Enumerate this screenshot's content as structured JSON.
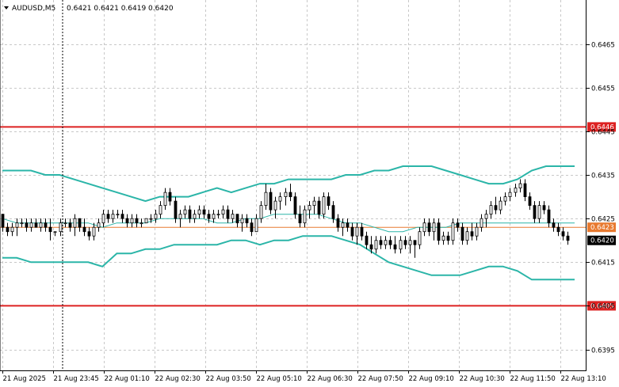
{
  "header": {
    "symbol": "AUDUSD,M5",
    "quote": "0.6421 0.6421 0.6419 0.6420",
    "menu_icon": "triangle-down-icon"
  },
  "chart_data": {
    "type": "candlestick",
    "symbol": "AUDUSD",
    "timeframe": "M5",
    "ylim": [
      0.63902,
      0.64751
    ],
    "y_ticks": [
      "0.6465",
      "0.6455",
      "0.6445",
      "0.6435",
      "0.6425",
      "0.6415",
      "0.6405",
      "0.6395"
    ],
    "y_tick_values": [
      0.6465,
      0.6455,
      0.6445,
      0.6435,
      0.6425,
      0.6415,
      0.6405,
      0.6395
    ],
    "x_ticks": [
      "21 Aug 2025",
      "21 Aug 23:45",
      "22 Aug 01:10",
      "22 Aug 02:30",
      "22 Aug 03:50",
      "22 Aug 05:10",
      "22 Aug 06:30",
      "22 Aug 07:50",
      "22 Aug 09:10",
      "22 Aug 10:30",
      "22 Aug 11:50",
      "22 Aug 13:10"
    ],
    "grid": true,
    "levels": [
      {
        "label": "0.6446",
        "value": 0.6446,
        "color": "#dd2222"
      },
      {
        "label": "0.6405",
        "value": 0.6405,
        "color": "#dd2222"
      }
    ],
    "ref_line": {
      "label": "0.6423",
      "value": 0.6423,
      "color": "#e87a30"
    },
    "bid": {
      "label": "0.6420",
      "value": 0.642,
      "color": "#000000"
    },
    "bands_color": "#2bb5a8",
    "candle_color": "#000000",
    "bollinger": {
      "upper": [
        0.6436,
        0.6436,
        0.6436,
        0.6435,
        0.6435,
        0.6434,
        0.6433,
        0.6432,
        0.6431,
        0.643,
        0.6429,
        0.643,
        0.643,
        0.643,
        0.6431,
        0.6432,
        0.6431,
        0.6432,
        0.6433,
        0.6433,
        0.6434,
        0.6434,
        0.6434,
        0.6434,
        0.6435,
        0.6435,
        0.6436,
        0.6436,
        0.6437,
        0.6437,
        0.6437,
        0.6436,
        0.6435,
        0.6434,
        0.6433,
        0.6433,
        0.6434,
        0.6436,
        0.6437,
        0.6437,
        0.6437
      ],
      "middle": [
        0.6425,
        0.6424,
        0.6424,
        0.6424,
        0.6424,
        0.6424,
        0.6424,
        0.6423,
        0.6424,
        0.6424,
        0.6424,
        0.6425,
        0.6425,
        0.6425,
        0.6425,
        0.6424,
        0.6424,
        0.6425,
        0.6425,
        0.6426,
        0.6426,
        0.6426,
        0.6426,
        0.6425,
        0.6424,
        0.6424,
        0.6423,
        0.6422,
        0.6422,
        0.6423,
        0.6423,
        0.6423,
        0.6424,
        0.6424,
        0.6424,
        0.6424,
        0.6424,
        0.6424,
        0.6424,
        0.6424,
        0.6424
      ],
      "lower": [
        0.6416,
        0.6416,
        0.6415,
        0.6415,
        0.6415,
        0.6415,
        0.6415,
        0.6414,
        0.6417,
        0.6417,
        0.6418,
        0.6418,
        0.6419,
        0.6419,
        0.6419,
        0.6419,
        0.642,
        0.642,
        0.6419,
        0.642,
        0.642,
        0.6421,
        0.6421,
        0.6421,
        0.642,
        0.6419,
        0.6417,
        0.6415,
        0.6414,
        0.6413,
        0.6412,
        0.6412,
        0.6412,
        0.6413,
        0.6414,
        0.6414,
        0.6413,
        0.6411,
        0.6411,
        0.6411,
        0.6411
      ]
    },
    "candles": [
      [
        0.6426,
        0.6425,
        0.6422,
        0.6423
      ],
      [
        0.6423,
        0.6424,
        0.6421,
        0.6422
      ],
      [
        0.6422,
        0.6424,
        0.6421,
        0.6423
      ],
      [
        0.6423,
        0.6425,
        0.6421,
        0.6424
      ],
      [
        0.6424,
        0.6425,
        0.6423,
        0.6424
      ],
      [
        0.6424,
        0.6425,
        0.6422,
        0.6423
      ],
      [
        0.6423,
        0.6425,
        0.6422,
        0.6424
      ],
      [
        0.6424,
        0.6425,
        0.6423,
        0.6423
      ],
      [
        0.6423,
        0.6425,
        0.6422,
        0.6424
      ],
      [
        0.6424,
        0.6425,
        0.6422,
        0.6423
      ],
      [
        0.6423,
        0.6425,
        0.642,
        0.6422
      ],
      [
        0.6422,
        0.6422,
        0.6421,
        0.6422
      ],
      [
        0.6422,
        0.6425,
        0.6421,
        0.6424
      ],
      [
        0.6424,
        0.6425,
        0.6423,
        0.6424
      ],
      [
        0.6424,
        0.6425,
        0.6422,
        0.6423
      ],
      [
        0.6423,
        0.6426,
        0.6421,
        0.6425
      ],
      [
        0.6425,
        0.6425,
        0.6422,
        0.6423
      ],
      [
        0.6423,
        0.6425,
        0.6421,
        0.6422
      ],
      [
        0.6422,
        0.6423,
        0.642,
        0.6421
      ],
      [
        0.6421,
        0.6424,
        0.642,
        0.6423
      ],
      [
        0.6423,
        0.6425,
        0.6422,
        0.6424
      ],
      [
        0.6424,
        0.6427,
        0.6423,
        0.6426
      ],
      [
        0.6426,
        0.6427,
        0.6424,
        0.6425
      ],
      [
        0.6425,
        0.6427,
        0.6424,
        0.6426
      ],
      [
        0.6426,
        0.6427,
        0.6425,
        0.6426
      ],
      [
        0.6426,
        0.6427,
        0.6424,
        0.6425
      ],
      [
        0.6425,
        0.6426,
        0.6423,
        0.6424
      ],
      [
        0.6424,
        0.6426,
        0.6423,
        0.6425
      ],
      [
        0.6425,
        0.6426,
        0.6423,
        0.6424
      ],
      [
        0.6424,
        0.6425,
        0.6423,
        0.6424
      ],
      [
        0.6424,
        0.6425,
        0.6424,
        0.6425
      ],
      [
        0.6425,
        0.6426,
        0.6424,
        0.6425
      ],
      [
        0.6425,
        0.6427,
        0.6424,
        0.6426
      ],
      [
        0.6426,
        0.6429,
        0.6425,
        0.6428
      ],
      [
        0.6428,
        0.6432,
        0.6427,
        0.6431
      ],
      [
        0.6431,
        0.6432,
        0.6428,
        0.6429
      ],
      [
        0.6429,
        0.643,
        0.6424,
        0.6425
      ],
      [
        0.6425,
        0.6427,
        0.6423,
        0.6426
      ],
      [
        0.6426,
        0.6428,
        0.6425,
        0.6427
      ],
      [
        0.6427,
        0.6428,
        0.6424,
        0.6425
      ],
      [
        0.6425,
        0.6427,
        0.6424,
        0.6426
      ],
      [
        0.6426,
        0.6428,
        0.6425,
        0.6427
      ],
      [
        0.6427,
        0.6428,
        0.6425,
        0.6426
      ],
      [
        0.6426,
        0.6427,
        0.6424,
        0.6425
      ],
      [
        0.6425,
        0.6427,
        0.6424,
        0.6426
      ],
      [
        0.6426,
        0.6427,
        0.6425,
        0.6426
      ],
      [
        0.6426,
        0.6428,
        0.6425,
        0.6427
      ],
      [
        0.6427,
        0.6428,
        0.6424,
        0.6425
      ],
      [
        0.6425,
        0.6427,
        0.6424,
        0.6426
      ],
      [
        0.6426,
        0.6426,
        0.6423,
        0.6424
      ],
      [
        0.6424,
        0.6426,
        0.6422,
        0.6425
      ],
      [
        0.6425,
        0.6426,
        0.6423,
        0.6424
      ],
      [
        0.6424,
        0.6425,
        0.6421,
        0.6422
      ],
      [
        0.6422,
        0.6426,
        0.6422,
        0.6425
      ],
      [
        0.6425,
        0.6429,
        0.6424,
        0.6428
      ],
      [
        0.6428,
        0.6433,
        0.6427,
        0.6431
      ],
      [
        0.6431,
        0.6432,
        0.6426,
        0.6427
      ],
      [
        0.6427,
        0.643,
        0.6425,
        0.6429
      ],
      [
        0.6429,
        0.6431,
        0.6427,
        0.643
      ],
      [
        0.643,
        0.6432,
        0.6428,
        0.6431
      ],
      [
        0.6431,
        0.6433,
        0.6429,
        0.643
      ],
      [
        0.643,
        0.6431,
        0.6425,
        0.6426
      ],
      [
        0.6426,
        0.6428,
        0.6423,
        0.6424
      ],
      [
        0.6424,
        0.6428,
        0.6423,
        0.6427
      ],
      [
        0.6427,
        0.6429,
        0.6425,
        0.6428
      ],
      [
        0.6428,
        0.643,
        0.6426,
        0.6429
      ],
      [
        0.6429,
        0.643,
        0.6425,
        0.6426
      ],
      [
        0.6426,
        0.6431,
        0.6425,
        0.643
      ],
      [
        0.643,
        0.6431,
        0.6427,
        0.6428
      ],
      [
        0.6428,
        0.6429,
        0.6424,
        0.6425
      ],
      [
        0.6425,
        0.6426,
        0.6422,
        0.6423
      ],
      [
        0.6423,
        0.6425,
        0.6421,
        0.6424
      ],
      [
        0.6424,
        0.6425,
        0.6422,
        0.6423
      ],
      [
        0.6423,
        0.6424,
        0.642,
        0.6421
      ],
      [
        0.6421,
        0.6424,
        0.6419,
        0.6423
      ],
      [
        0.6423,
        0.6424,
        0.642,
        0.6421
      ],
      [
        0.6421,
        0.6422,
        0.6418,
        0.6419
      ],
      [
        0.6419,
        0.6421,
        0.6417,
        0.6418
      ],
      [
        0.6418,
        0.6421,
        0.6417,
        0.642
      ],
      [
        0.642,
        0.6421,
        0.6418,
        0.6419
      ],
      [
        0.6419,
        0.6421,
        0.6418,
        0.642
      ],
      [
        0.642,
        0.6421,
        0.6418,
        0.6419
      ],
      [
        0.6419,
        0.6421,
        0.6417,
        0.6418
      ],
      [
        0.6418,
        0.6421,
        0.6417,
        0.642
      ],
      [
        0.642,
        0.6421,
        0.6418,
        0.6419
      ],
      [
        0.6419,
        0.6421,
        0.6417,
        0.642
      ],
      [
        0.642,
        0.642,
        0.6416,
        0.6419
      ],
      [
        0.6419,
        0.6423,
        0.6418,
        0.6422
      ],
      [
        0.6422,
        0.6425,
        0.6421,
        0.6424
      ],
      [
        0.6424,
        0.6425,
        0.6421,
        0.6422
      ],
      [
        0.6422,
        0.6425,
        0.642,
        0.6424
      ],
      [
        0.6424,
        0.6425,
        0.6419,
        0.642
      ],
      [
        0.642,
        0.6422,
        0.6419,
        0.6421
      ],
      [
        0.6421,
        0.6422,
        0.6419,
        0.642
      ],
      [
        0.642,
        0.6425,
        0.6419,
        0.6424
      ],
      [
        0.6424,
        0.6425,
        0.6422,
        0.6423
      ],
      [
        0.6423,
        0.6424,
        0.6419,
        0.642
      ],
      [
        0.642,
        0.6423,
        0.6419,
        0.6422
      ],
      [
        0.6422,
        0.6424,
        0.642,
        0.6421
      ],
      [
        0.6421,
        0.6424,
        0.642,
        0.6423
      ],
      [
        0.6423,
        0.6426,
        0.6422,
        0.6425
      ],
      [
        0.6425,
        0.6427,
        0.6423,
        0.6426
      ],
      [
        0.6426,
        0.6429,
        0.6425,
        0.6428
      ],
      [
        0.6428,
        0.643,
        0.6426,
        0.6427
      ],
      [
        0.6427,
        0.643,
        0.6426,
        0.6429
      ],
      [
        0.6429,
        0.6431,
        0.6428,
        0.643
      ],
      [
        0.643,
        0.6432,
        0.6429,
        0.6431
      ],
      [
        0.6431,
        0.6433,
        0.643,
        0.6432
      ],
      [
        0.6432,
        0.6434,
        0.6431,
        0.6433
      ],
      [
        0.6433,
        0.6434,
        0.6429,
        0.643
      ],
      [
        0.643,
        0.6431,
        0.6427,
        0.6428
      ],
      [
        0.6428,
        0.6429,
        0.6424,
        0.6425
      ],
      [
        0.6425,
        0.6429,
        0.6424,
        0.6428
      ],
      [
        0.6428,
        0.6429,
        0.6426,
        0.6427
      ],
      [
        0.6427,
        0.6428,
        0.6423,
        0.6424
      ],
      [
        0.6424,
        0.6425,
        0.6422,
        0.6423
      ],
      [
        0.6423,
        0.6424,
        0.6421,
        0.6422
      ],
      [
        0.6422,
        0.6423,
        0.642,
        0.6421
      ],
      [
        0.6421,
        0.6422,
        0.6419,
        0.642
      ]
    ]
  }
}
